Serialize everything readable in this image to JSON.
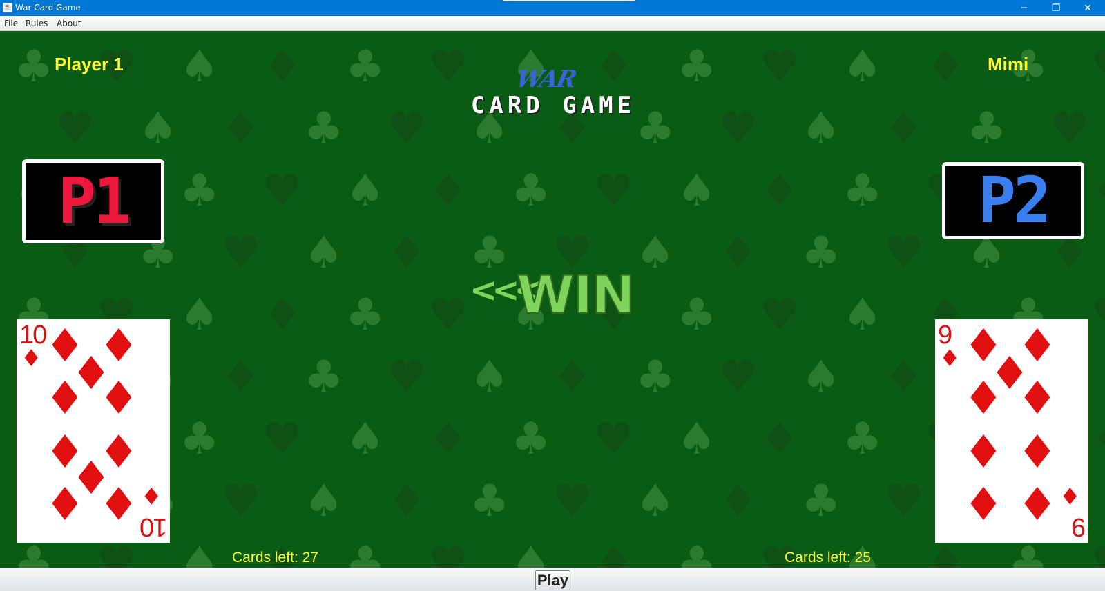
{
  "window": {
    "title": "War Card Game",
    "icon": "java-app-icon",
    "controls": {
      "minimize": "─",
      "maximize": "❐",
      "close": "✕"
    }
  },
  "menu": {
    "items": [
      {
        "label": "File"
      },
      {
        "label": "Rules"
      },
      {
        "label": "About"
      }
    ]
  },
  "game": {
    "background_color": "#0a5b14",
    "logo": {
      "script": "WAR",
      "subtitle": "CARD GAME"
    },
    "players": [
      {
        "name": "Player 1",
        "badge": "P1",
        "badge_color": "#f0173c",
        "card_rank": "10",
        "card_suit": "diamonds",
        "cards_left": "Cards left: 27"
      },
      {
        "name": "Mimi",
        "badge": "P2",
        "badge_color": "#3a7ff0",
        "card_rank": "9",
        "card_suit": "diamonds",
        "cards_left": "Cards left: 25"
      }
    ],
    "result": {
      "arrows": "<<<",
      "text": "WIN",
      "winner_direction": "left",
      "color": "#7ed35a"
    },
    "suit_color": "#e01010",
    "pip_glyph": "♦"
  },
  "controls": {
    "play_label": "Play"
  }
}
